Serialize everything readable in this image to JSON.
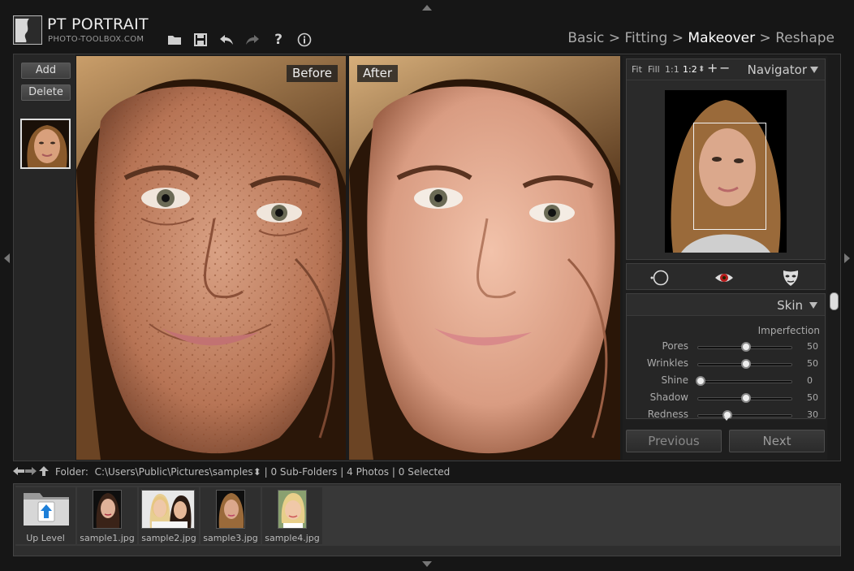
{
  "app": {
    "title": "PT PORTRAIT",
    "subtitle": "PHOTO-TOOLBOX.COM"
  },
  "toolbar": {
    "icons": [
      "folder-icon",
      "save-icon",
      "undo-icon",
      "redo-icon",
      "help-icon",
      "info-icon"
    ],
    "help_label": "?"
  },
  "workflow": {
    "steps": [
      "Basic",
      "Fitting",
      "Makeover",
      "Reshape"
    ],
    "separator": ">",
    "active": "Makeover"
  },
  "left_panel": {
    "add_label": "Add",
    "delete_label": "Delete"
  },
  "preview": {
    "before_label": "Before",
    "after_label": "After"
  },
  "navigator": {
    "title": "Navigator",
    "zoom_options": [
      "Fit",
      "Fill",
      "1:1",
      "1:2"
    ],
    "selected_zoom": "1:2",
    "spin_glyph": "⬍",
    "zoom_in": "+",
    "zoom_out": "−"
  },
  "tools": {
    "icons": [
      "circle-brush-icon",
      "eye-icon",
      "mask-icon"
    ]
  },
  "skin": {
    "title": "Skin",
    "section": "Imperfection",
    "sliders": [
      {
        "name": "pores",
        "label": "Pores",
        "value": 50
      },
      {
        "name": "wrinkles",
        "label": "Wrinkles",
        "value": 50
      },
      {
        "name": "shine",
        "label": "Shine",
        "value": 0
      },
      {
        "name": "shadow",
        "label": "Shadow",
        "value": 50
      },
      {
        "name": "redness",
        "label": "Redness",
        "value": 30
      }
    ]
  },
  "navigation": {
    "previous_label": "Previous",
    "next_label": "Next"
  },
  "folder_bar": {
    "folder_label": "Folder:",
    "path": "C:\\Users\\Public\\Pictures\\samples",
    "spin_glyph": "⬍",
    "subfolders": "0 Sub-Folders",
    "photos": "4 Photos",
    "selected": "0 Selected",
    "separator": "|"
  },
  "files": {
    "up_level": "Up Level",
    "items": [
      "sample1.jpg",
      "sample2.jpg",
      "sample3.jpg",
      "sample4.jpg"
    ]
  },
  "colors": {
    "background": "#161616",
    "panel": "#2a2a2a",
    "text": "#cccccc",
    "active_text": "#ffffff",
    "folder_blue": "#1e7fd8"
  }
}
